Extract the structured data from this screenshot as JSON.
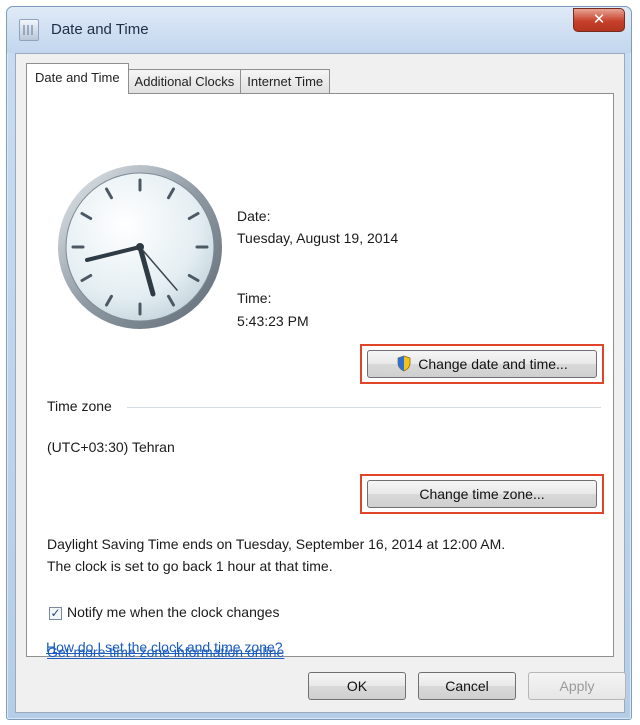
{
  "window": {
    "title": "Date and Time",
    "close_glyph": "✕"
  },
  "tabs": [
    {
      "label": "Date and Time",
      "active": true
    },
    {
      "label": "Additional Clocks",
      "active": false
    },
    {
      "label": "Internet Time",
      "active": false
    }
  ],
  "datetime": {
    "date_label": "Date:",
    "date_value": "Tuesday, August 19, 2014",
    "time_label": "Time:",
    "time_value": "5:43:23 PM",
    "change_button": "Change date and time..."
  },
  "timezone": {
    "section_label": "Time zone",
    "value": "(UTC+03:30) Tehran",
    "change_button": "Change time zone..."
  },
  "dst": {
    "line1": "Daylight Saving Time ends on Tuesday, September 16, 2014 at 12:00 AM.",
    "line2": "The clock is set to go back 1 hour at that time."
  },
  "notify": {
    "label": "Notify me when the clock changes",
    "checked": true,
    "glyph": "✓"
  },
  "links": {
    "more_info": "Get more time zone information online",
    "how_to": "How do I set the clock and time zone?"
  },
  "footer": {
    "ok": "OK",
    "cancel": "Cancel",
    "apply": "Apply"
  },
  "colors": {
    "highlight": "#e0452a",
    "link": "#1a5cbf",
    "accent": "#c7402a"
  },
  "icons": {
    "title": "calendar-clock-icon",
    "clock": "analog-clock-icon",
    "shield": "uac-shield-icon",
    "close": "close-icon"
  }
}
